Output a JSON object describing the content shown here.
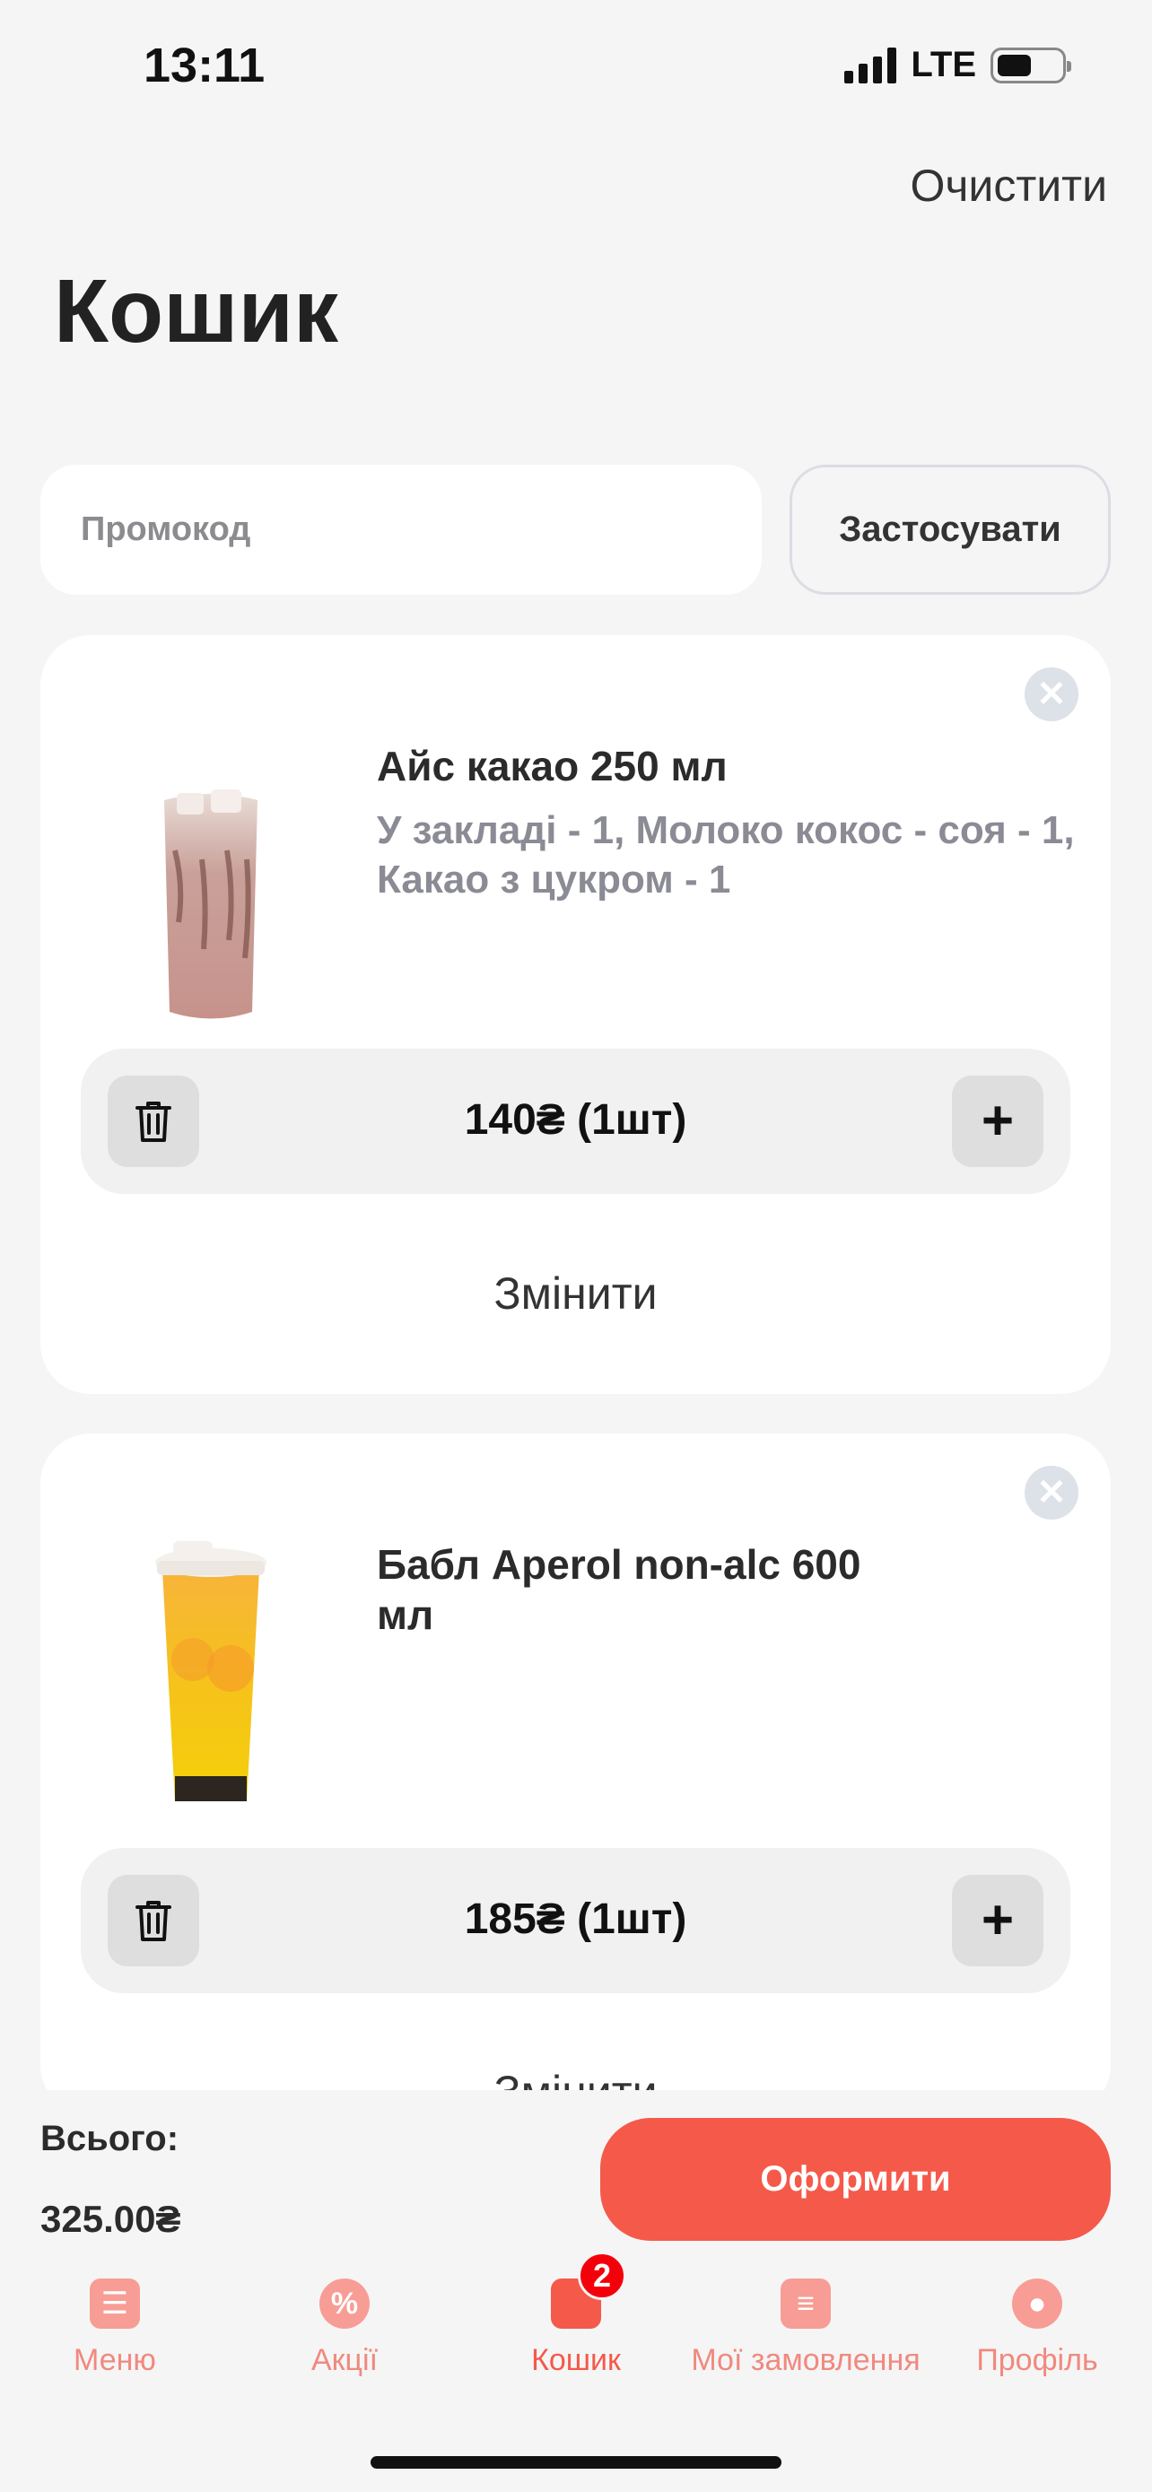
{
  "status_bar": {
    "time": "13:11",
    "network": "LTE"
  },
  "header": {
    "clear_label": "Очистити",
    "title": "Кошик"
  },
  "promo": {
    "placeholder": "Промокод",
    "apply_label": "Застосувати"
  },
  "cart_items": [
    {
      "name": "Айс какао 250 мл",
      "options": " У закладі - 1, Молоко кокос - соя - 1, Какао з цукром - 1",
      "price_qty": "140₴  (1шт)",
      "edit_label": "Змінити"
    },
    {
      "name": "Бабл Aperol non-alc 600 мл",
      "options": "",
      "price_qty": "185₴  (1шт)",
      "edit_label": "Змінити"
    }
  ],
  "summary": {
    "total_label": "Всього:",
    "total_value": "325.00₴",
    "checkout_label": "Оформити"
  },
  "tabbar": {
    "items": [
      {
        "label": "Меню",
        "icon": "menu-icon"
      },
      {
        "label": "Акції",
        "icon": "discount-icon"
      },
      {
        "label": "Кошик",
        "icon": "cart-icon",
        "badge": "2"
      },
      {
        "label": "Мої замовлення",
        "icon": "receipt-icon"
      },
      {
        "label": "Профіль",
        "icon": "profile-icon"
      }
    ]
  },
  "colors": {
    "accent": "#f5594a",
    "accent_light": "#f79d95",
    "badge": "#f4000a",
    "background": "#f5f5f5"
  }
}
